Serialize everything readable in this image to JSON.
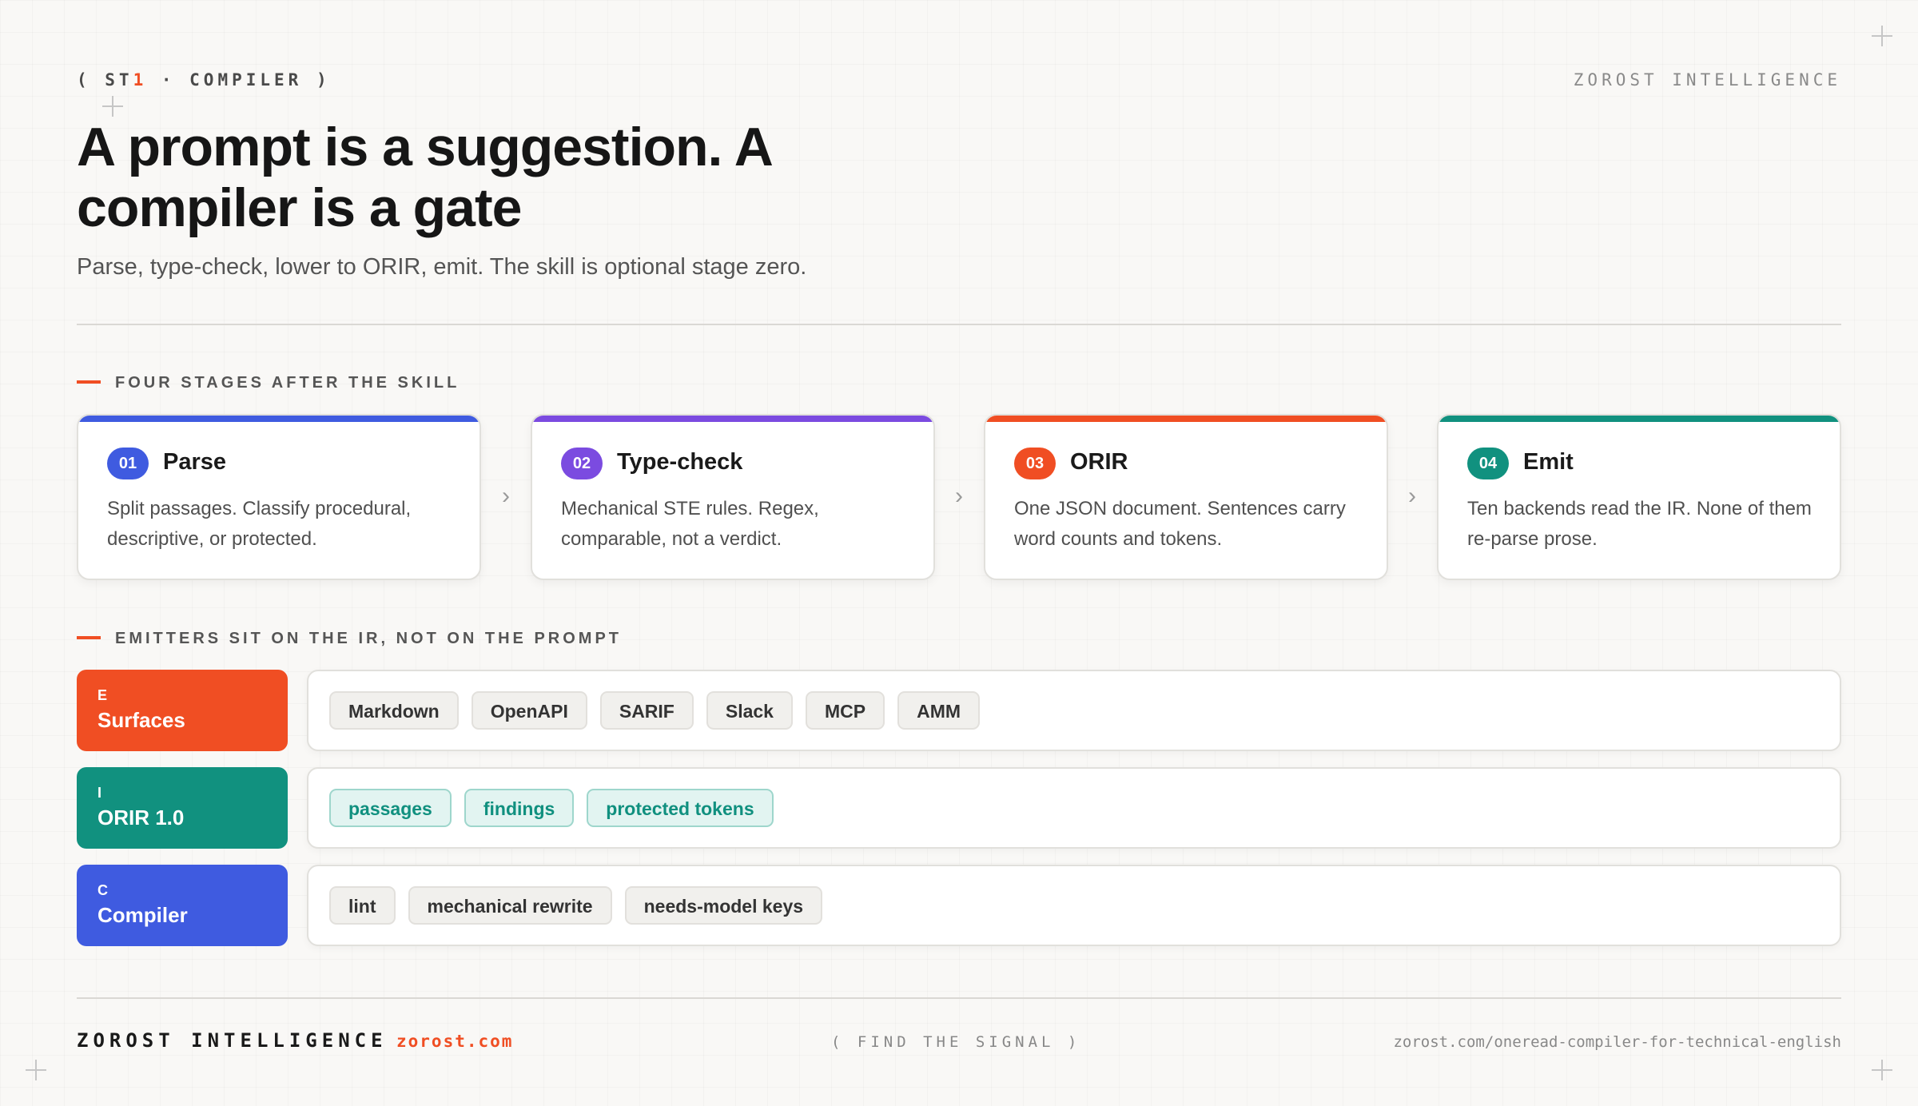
{
  "header": {
    "eyebrow_pre": "( ST",
    "eyebrow_accent": "1",
    "eyebrow_post": " · COMPILER )",
    "brand": "ZOROST INTELLIGENCE"
  },
  "hero": {
    "title": "A prompt is a suggestion. A compiler is a gate",
    "subtitle": "Parse, type-check, lower to ORIR, emit. The skill is optional stage zero."
  },
  "stages_section": {
    "label": "FOUR STAGES AFTER THE SKILL",
    "stages": [
      {
        "num": "01",
        "name": "Parse",
        "desc": "Split passages. Classify procedural, descriptive, or protected.",
        "color": "#3f5be0"
      },
      {
        "num": "02",
        "name": "Type-check",
        "desc": "Mechanical STE rules. Regex, comparable, not a verdict.",
        "color": "#7b4be0"
      },
      {
        "num": "03",
        "name": "ORIR",
        "desc": "One JSON document. Sentences carry word counts and tokens.",
        "color": "#f04e23"
      },
      {
        "num": "04",
        "name": "Emit",
        "desc": "Ten backends read the IR. None of them re-parse prose.",
        "color": "#11917f"
      }
    ],
    "arrow": "›"
  },
  "emitters_section": {
    "label": "EMITTERS SIT ON THE IR, NOT ON THE PROMPT",
    "rows": [
      {
        "letter": "E",
        "name": "Surfaces",
        "color": "#f04e23",
        "chips": [
          "Markdown",
          "OpenAPI",
          "SARIF",
          "Slack",
          "MCP",
          "AMM"
        ]
      },
      {
        "letter": "I",
        "name": "ORIR 1.0",
        "color": "#11917f",
        "chips": [
          "passages",
          "findings",
          "protected tokens"
        ]
      },
      {
        "letter": "C",
        "name": "Compiler",
        "color": "#3f5be0",
        "chips": [
          "lint",
          "mechanical rewrite",
          "needs-model keys"
        ]
      }
    ]
  },
  "footer": {
    "brand": "ZOROST INTELLIGENCE",
    "url": "zorost.com",
    "tagline": "( FIND THE SIGNAL )",
    "link": "zorost.com/oneread-compiler-for-technical-english"
  }
}
